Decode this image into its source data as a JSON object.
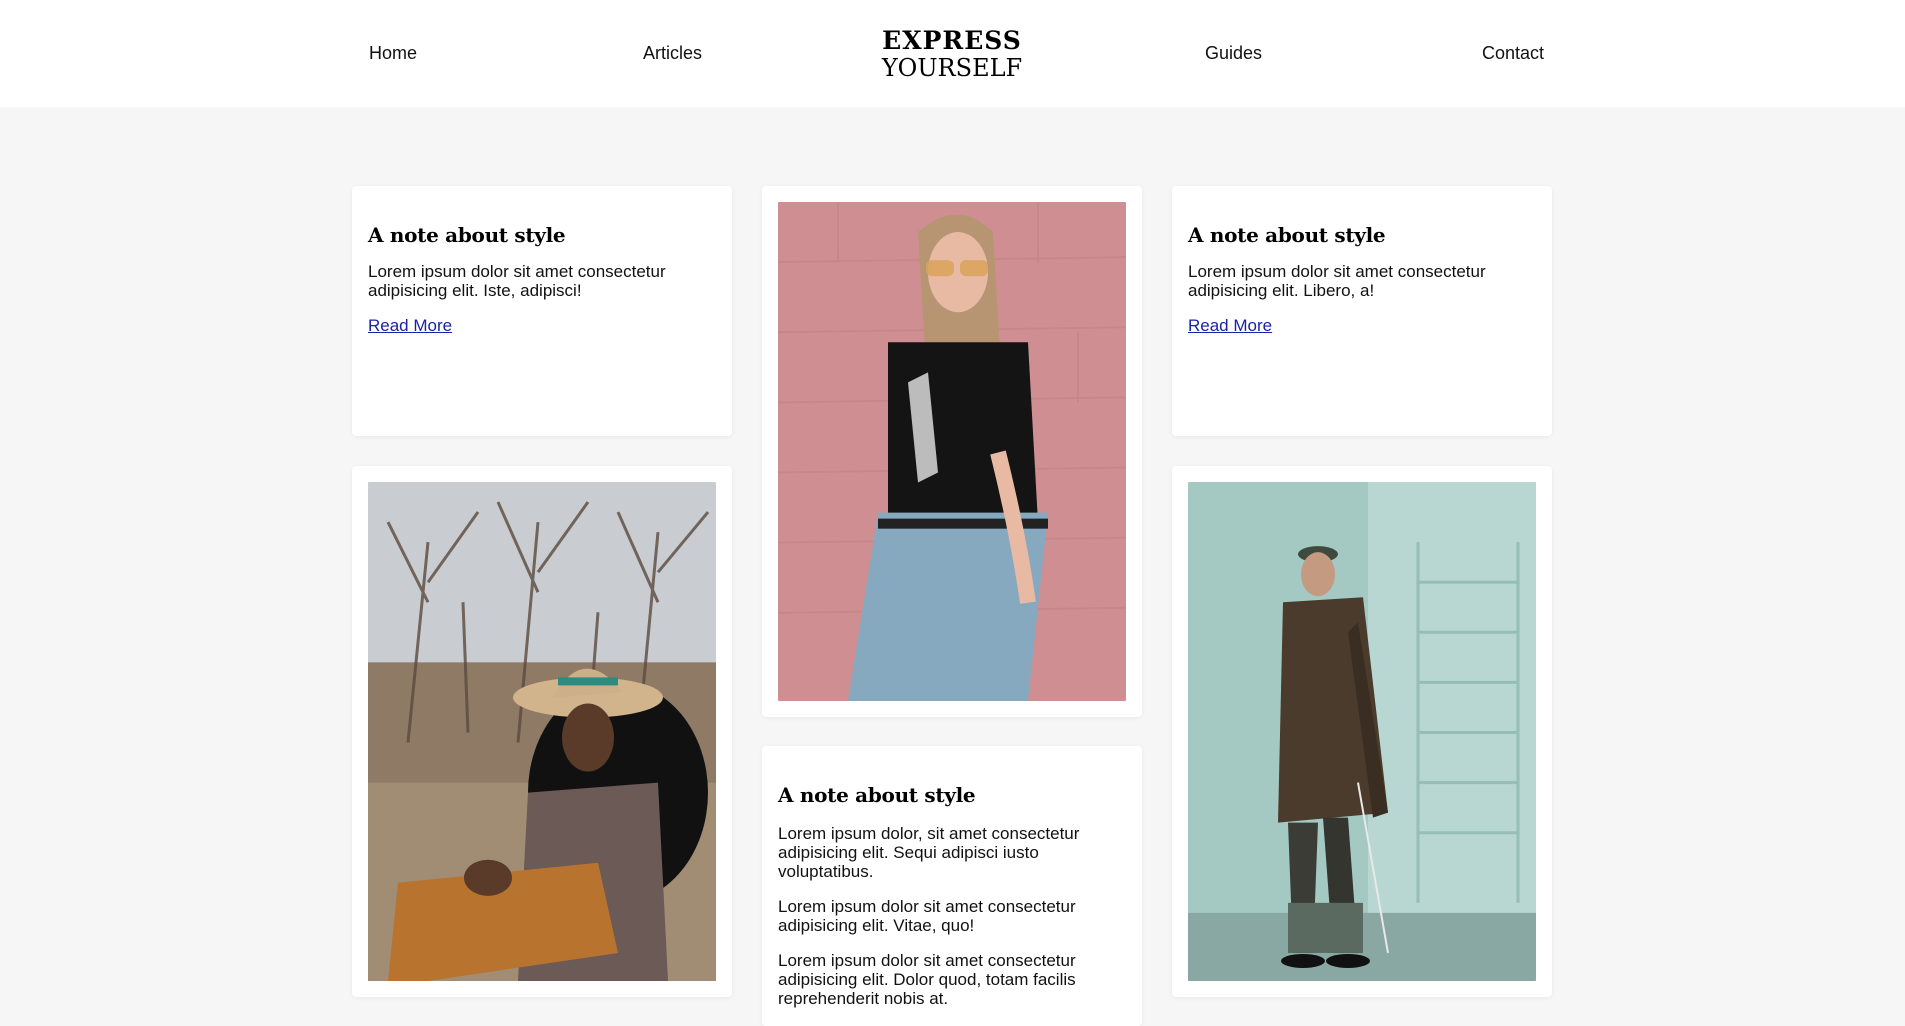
{
  "nav": {
    "home": "Home",
    "articles": "Articles",
    "guides": "Guides",
    "contact": "Contact"
  },
  "logo": {
    "line1": "EXPRESS",
    "line2": "YOURSELF"
  },
  "cards": {
    "note1": {
      "title": "A note about style",
      "text": "Lorem ipsum dolor sit amet consectetur adipisicing elit. Iste, adipisci!",
      "link": "Read More"
    },
    "note2": {
      "title": "A note about style",
      "text": "Lorem ipsum dolor sit amet consectetur adipisicing elit. Libero, a!",
      "link": "Read More"
    },
    "note3": {
      "title": "A note about style",
      "paragraphs": [
        "Lorem ipsum dolor, sit amet consectetur adipisicing elit. Sequi adipisci iusto voluptatibus.",
        "Lorem ipsum dolor sit amet consectetur adipisicing elit. Vitae, quo!",
        "Lorem ipsum dolor sit amet consectetur adipisicing elit. Dolor quod, totam facilis reprehenderit nobis at."
      ]
    }
  },
  "colors": {
    "page_bg": "#f6f6f6",
    "card_bg": "#ffffff",
    "link": "#1a23a8"
  }
}
